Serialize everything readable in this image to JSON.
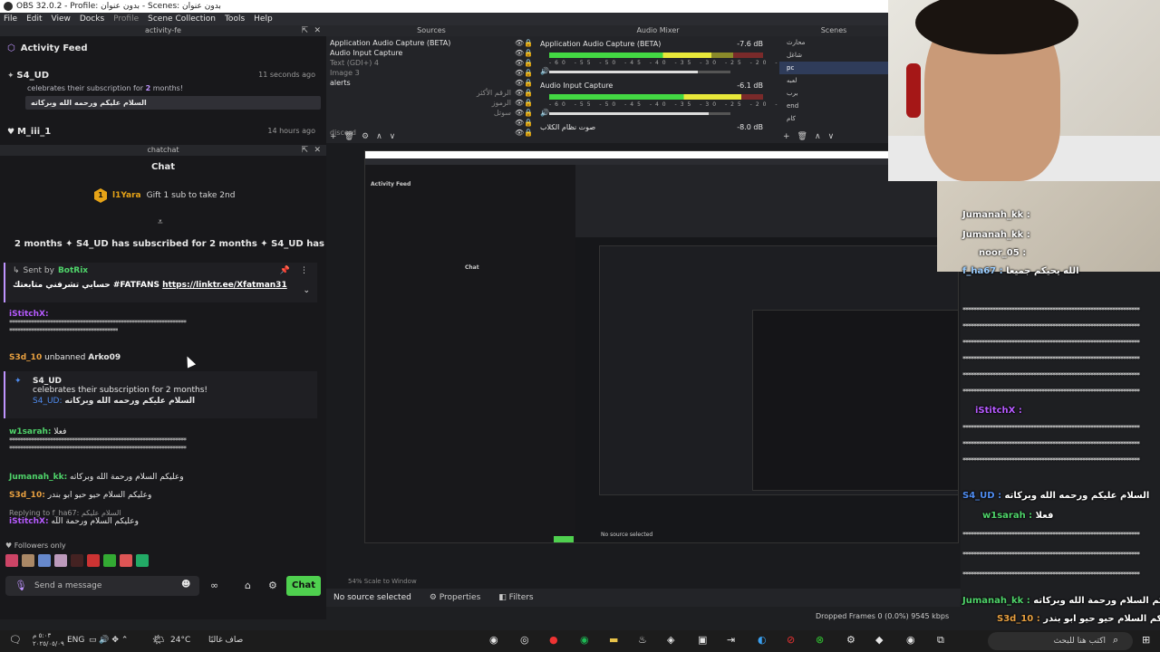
{
  "window": {
    "title": "OBS 32.0.2 - Profile: بدون عنوان - Scenes: بدون عنوان"
  },
  "menu": [
    "File",
    "Edit",
    "View",
    "Docks",
    "Profile",
    "Scene Collection",
    "Tools",
    "Help"
  ],
  "activity_dock": {
    "title": "activity-fe",
    "header": "Activity Feed",
    "items": [
      {
        "name": "S4_UD",
        "time": "11 seconds ago",
        "msg_prefix": "celebrates their subscription for ",
        "months": "2",
        "msg_suffix": " months!",
        "quote": "السلام عليكم ورحمه الله وبركاته"
      },
      {
        "name": "M_iii_1",
        "time": "14 hours ago"
      }
    ]
  },
  "chat_dock": {
    "title": "chatchat",
    "header": "Chat",
    "gift_user": "l1Yara",
    "gift_count": "1",
    "gift_text": "Gift 1 sub to take 2nd",
    "ticker": "2 months  ✦  S4_UD has subscribed for 2 months  ✦  S4_UD has subscribe",
    "pinned_sender_label": "Sent by",
    "pinned_sender": "BotRix",
    "pinned_message": "حسابي تشرفني متابعتك #FATFANS",
    "pinned_link": "https://linktr.ee/Xfatman31",
    "messages": [
      {
        "user": "iStitchX:",
        "stars": "*****************************************************************"
      },
      {
        "user": "S3d_10",
        "text": "unbanned",
        "target": "Arko09"
      },
      {
        "user": "w1sarah:",
        "text": "فعلا"
      },
      {
        "user": "Jumanah_kk:",
        "text": "وعليكم السلام ورحمة الله وبركاته"
      },
      {
        "user": "S3d_10:",
        "text": "وعليكم السلام حيو حيو ابو بندر"
      },
      {
        "reply": "Replying to f_ha67:",
        "reply_text": "السلام عليكم",
        "user": "iStitchX:",
        "text": "وعليكم السلام ورحمة الله"
      }
    ],
    "sub_card": {
      "name": "S4_UD",
      "msg": "celebrates their subscription for 2 months!",
      "badge_user": "S4_UD:",
      "quote": "السلام عليكم ورحمه الله وبركاته"
    },
    "followers_only": "Followers only",
    "send_placeholder": "Send a message",
    "chat_button": "Chat"
  },
  "sources": {
    "title": "Sources",
    "items": [
      {
        "name": "Application Audio Capture (BETA)",
        "dim": false
      },
      {
        "name": "Audio Input Capture",
        "dim": false
      },
      {
        "name": "Text (GDI+) 4",
        "dim": true
      },
      {
        "name": "Image 3",
        "dim": true
      },
      {
        "name": "alerts",
        "dim": false
      },
      {
        "name": "الرقم الأكثر",
        "dim": true
      },
      {
        "name": "الرموز",
        "dim": true
      },
      {
        "name": "سوتل",
        "dim": true
      },
      {
        "name": "",
        "dim": true
      },
      {
        "name": "discord",
        "dim": true
      }
    ]
  },
  "mixer": {
    "title": "Audio Mixer",
    "channels": [
      {
        "name": "Application Audio Capture (BETA)",
        "db": "-7.6 dB",
        "level": 0.76,
        "volume": 0.82
      },
      {
        "name": "Audio Input Capture",
        "db": "-6.1 dB",
        "level": 0.9,
        "volume": 0.88
      },
      {
        "name": "صوت نظام الكلاب",
        "db": "-8.0 dB"
      }
    ],
    "ticks": "-60 -55 -50 -45 -40 -35 -30 -25 -20 -15 -10 -5 0"
  },
  "scenes": {
    "title": "Scenes",
    "items": [
      "محارث",
      "شاغل",
      "pc",
      "لعبه",
      "برب",
      "end",
      "كام"
    ],
    "selected": 2
  },
  "nested": {
    "header": "Activity Feed",
    "chat": "Chat",
    "source_status": "No source selected",
    "chat_btn": "Chat"
  },
  "preview_footer": "54%      Scale to Window",
  "status": {
    "no_source": "No source selected",
    "properties": "Properties",
    "filters": "Filters",
    "dropped": "Dropped Frames 0 (0.0%)",
    "bitrate": "9545 kbps"
  },
  "overlay_chat": [
    {
      "user": "Jumanah_kk :",
      "text": ""
    },
    {
      "user": "Jumanah_kk :",
      "text": ""
    },
    {
      "user": "noor_05 :",
      "text": ""
    },
    {
      "user": "f_ha67 :",
      "text": "الله يحيكم جميعا"
    },
    {
      "user": "iStitchX :",
      "text": ""
    },
    {
      "user": "S4_UD :",
      "text": "السلام عليكم ورحمه الله وبركاته"
    },
    {
      "user": "w1sarah :",
      "text": "فعلا"
    },
    {
      "user": "Jumanah_kk :",
      "text": "وعليكم السلام ورحمة الله وبركاته"
    },
    {
      "user": "S3d_10 :",
      "text": "وعليكم السلام حيو حيو ابو بندر"
    }
  ],
  "taskbar": {
    "time": "٥:٠٣ م",
    "date": "٢٠٢٥/٠٥/٠٩",
    "lang": "ENG",
    "weather": "24°C",
    "weather_text": "صاف غالبًا",
    "search": "اكتب هنا للبحث"
  }
}
